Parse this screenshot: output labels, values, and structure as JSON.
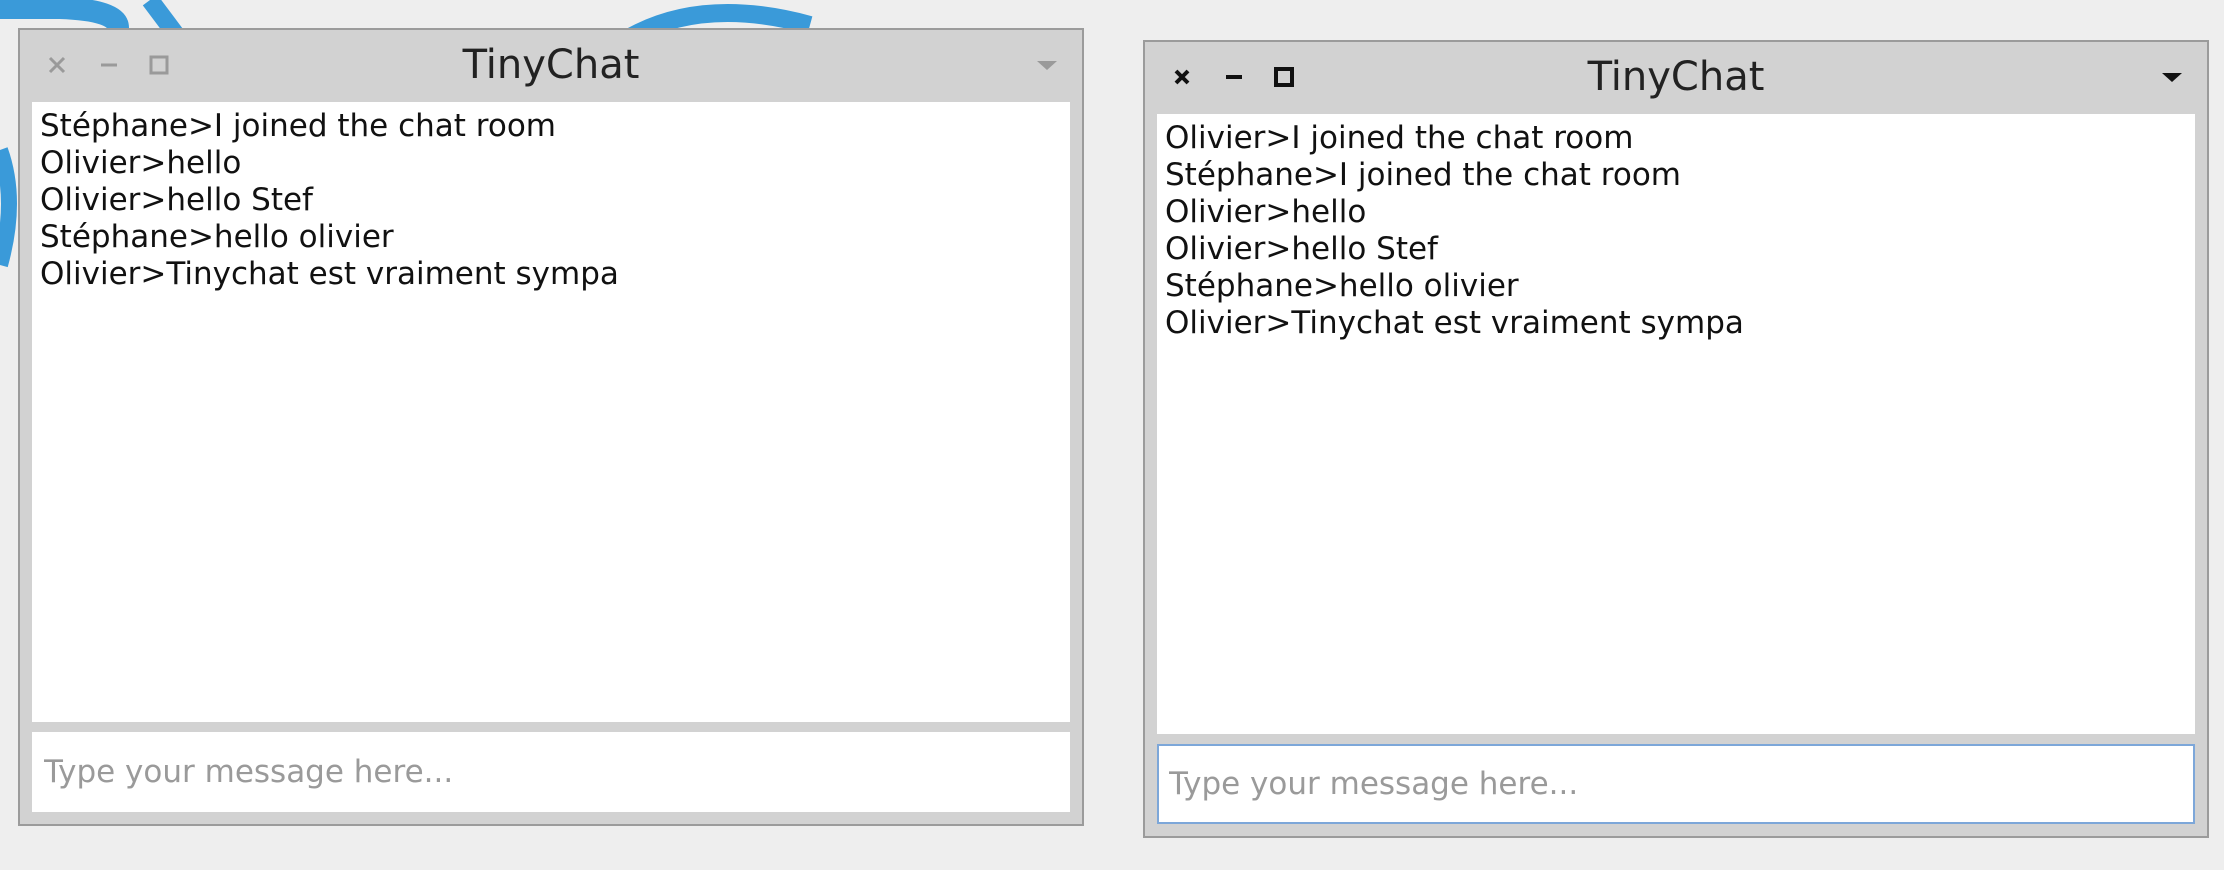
{
  "windows": [
    {
      "title": "TinyChat",
      "active": false,
      "messages": [
        "Stéphane>I joined the chat room",
        "Olivier>hello",
        "Olivier>hello Stef",
        "Stéphane>hello olivier",
        "Olivier>Tinychat est vraiment sympa"
      ],
      "input_placeholder": "Type your message here...",
      "input_value": ""
    },
    {
      "title": "TinyChat",
      "active": true,
      "messages": [
        "Olivier>I joined the chat room",
        "Stéphane>I joined the chat room",
        "Olivier>hello",
        "Olivier>hello Stef",
        "Stéphane>hello olivier",
        "Olivier>Tinychat est vraiment sympa"
      ],
      "input_placeholder": "Type your message here...",
      "input_value": ""
    }
  ],
  "icons": {
    "close": "close-icon",
    "minimize": "minimize-icon",
    "maximize": "maximize-icon",
    "menu": "chevron-down-icon"
  },
  "colors": {
    "window_frame": "#d2d2d2",
    "focus_border": "#7da7d9",
    "backdrop_logo": "#3a9ad9"
  }
}
